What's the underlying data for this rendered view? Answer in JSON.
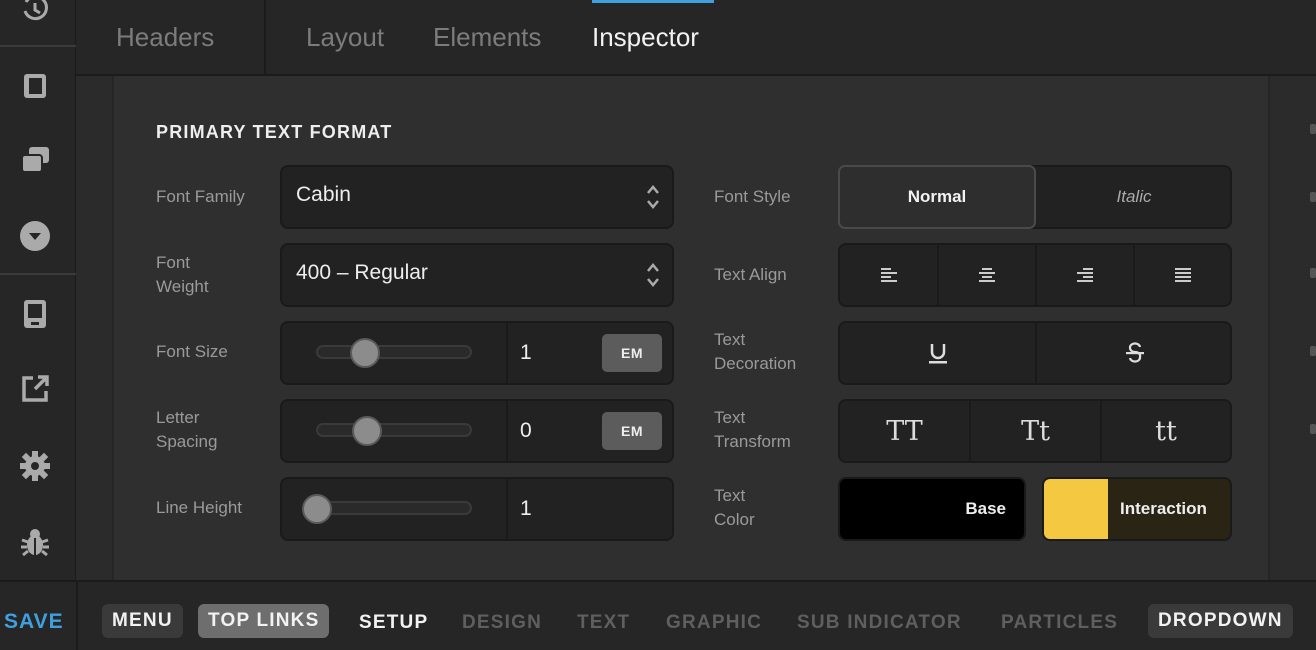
{
  "topbar": {
    "tabs": [
      {
        "label": "Headers"
      },
      {
        "label": "Layout"
      },
      {
        "label": "Elements"
      },
      {
        "label": "Inspector"
      }
    ],
    "active": "Inspector"
  },
  "panel": {
    "section_title": "PRIMARY TEXT FORMAT",
    "font_family": {
      "label": "Font Family",
      "value": "Cabin"
    },
    "font_weight": {
      "label_l1": "Font",
      "label_l2": "Weight",
      "value": "400 – Regular"
    },
    "font_size": {
      "label": "Font Size",
      "value": "1",
      "unit": "EM",
      "slider_fraction": 0.22
    },
    "letter_spacing": {
      "label_l1": "Letter",
      "label_l2": "Spacing",
      "value": "0",
      "unit": "EM",
      "slider_fraction": 0.23
    },
    "line_height": {
      "label": "Line Height",
      "value": "1",
      "slider_fraction": 0.0
    },
    "font_style": {
      "label": "Font Style",
      "options": [
        "Normal",
        "Italic"
      ],
      "selected": "Normal"
    },
    "text_align": {
      "label": "Text Align",
      "options": [
        "left-align-icon",
        "center-align-icon",
        "right-align-icon",
        "justify-icon"
      ]
    },
    "text_decoration": {
      "label_l1": "Text",
      "label_l2": "Decoration",
      "options": [
        "underline-icon",
        "strikethrough-icon"
      ]
    },
    "text_transform": {
      "label_l1": "Text",
      "label_l2": "Transform",
      "options": [
        "TT",
        "Tt",
        "tt"
      ]
    },
    "text_color": {
      "label_l1": "Text",
      "label_l2": "Color",
      "base_label": "Base",
      "base_color": "#000000",
      "interaction_label": "Interaction",
      "interaction_color": "#f5c842"
    }
  },
  "bottombar": {
    "save": "SAVE",
    "items": [
      "MENU",
      "TOP LINKS",
      "SETUP",
      "DESIGN",
      "TEXT",
      "GRAPHIC",
      "SUB INDICATOR",
      "PARTICLES",
      "DROPDOWN"
    ],
    "active": "SETUP"
  },
  "colors": {
    "accent": "#3fa0e0",
    "interaction": "#f5c842"
  }
}
